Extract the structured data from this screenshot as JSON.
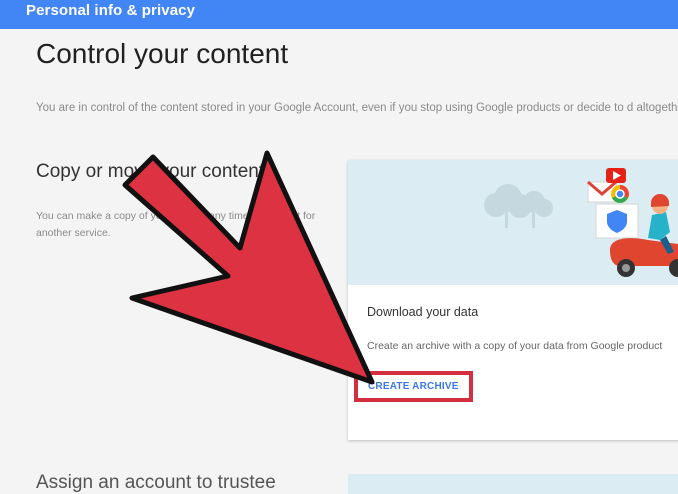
{
  "header": {
    "title": "Personal info & privacy"
  },
  "page": {
    "title": "Control your content",
    "intro": "You are in control of the content stored in your Google Account, even if you stop using Google products or decide to d altogether."
  },
  "copy_section": {
    "heading": "Copy or move your content",
    "description": "You can make a copy of your data at any time, and use it for another service."
  },
  "download_card": {
    "title": "Download your data",
    "description": "Create an archive with a copy of your data from Google product",
    "button_label": "CREATE ARCHIVE"
  },
  "assign_section": {
    "heading": "Assign an account to trustee"
  },
  "colors": {
    "header_bg": "#4285f4",
    "button_text": "#3b78e7",
    "highlight": "#d32f3f",
    "arrow_fill": "#dc3242"
  },
  "icons": [
    "trees-icon",
    "gmail-icon",
    "youtube-icon",
    "chrome-icon",
    "shield-icon",
    "scooter-rider-icon",
    "pointer-arrow-icon"
  ]
}
